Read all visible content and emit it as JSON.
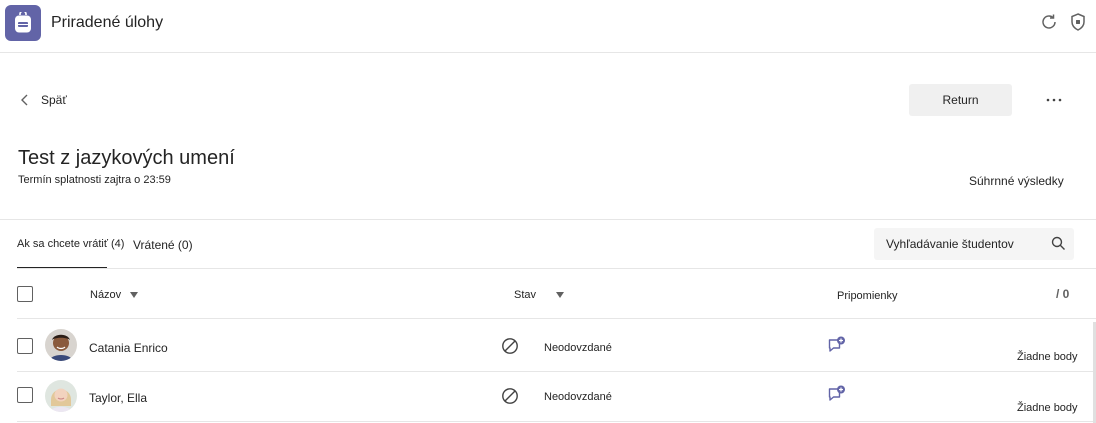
{
  "app": {
    "title": "Priradené úlohy",
    "icon": "backpack-icon",
    "accent": "#6264a7"
  },
  "topbar": {
    "icons": [
      "refresh-icon",
      "shield-icon"
    ]
  },
  "nav": {
    "back_label": "Späť",
    "return_label": "Return",
    "more_icon": "more-icon"
  },
  "assignment": {
    "title": "Test z jazykových umení",
    "due": "Termín splatnosti zajtra o 23:59",
    "summary_link": "Súhrnné výsledky"
  },
  "tabs": [
    {
      "label": "Ak sa chcete vrátiť (4)",
      "active": true
    },
    {
      "label": "Vrátené (0)",
      "active": false
    }
  ],
  "search": {
    "placeholder": "Vyhľadávanie študentov"
  },
  "table": {
    "headers": {
      "name": "Názov",
      "status": "Stav",
      "feedback": "Pripomienky",
      "points": "/ 0"
    },
    "rows": [
      {
        "name": "Catania Enrico",
        "status": "Neodovzdané",
        "status_icon": "blocked-icon",
        "feedback_icon": "add-feedback-icon",
        "points": "Žiadne body"
      },
      {
        "name": "Taylor, Ella",
        "status": "Neodovzdané",
        "status_icon": "blocked-icon",
        "feedback_icon": "add-feedback-icon",
        "points": "Žiadne body"
      }
    ]
  }
}
